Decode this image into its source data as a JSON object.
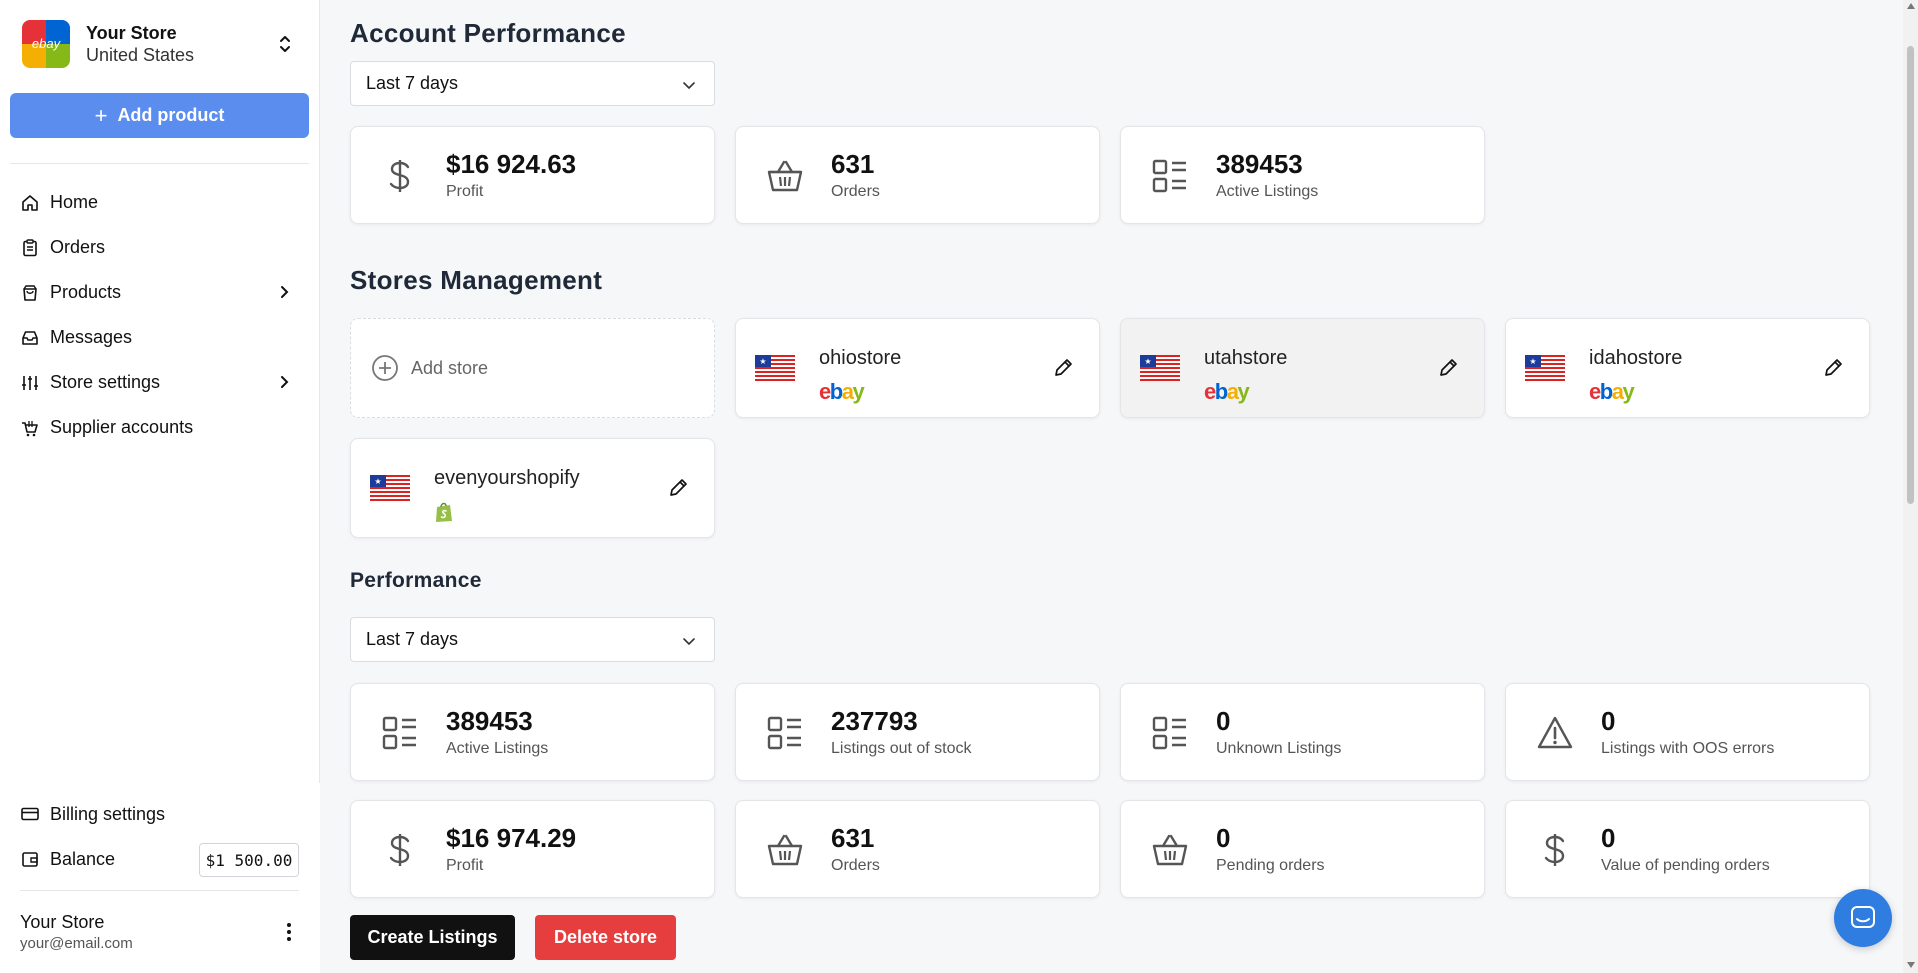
{
  "sidebar": {
    "store_name": "Your Store",
    "store_country": "United States",
    "logo_text": "ebay",
    "add_product_label": "Add product",
    "nav": [
      {
        "label": "Home",
        "icon": "home-icon"
      },
      {
        "label": "Orders",
        "icon": "clipboard-icon"
      },
      {
        "label": "Products",
        "icon": "bag-icon",
        "has_children": true
      },
      {
        "label": "Messages",
        "icon": "inbox-icon"
      },
      {
        "label": "Store settings",
        "icon": "sliders-icon",
        "has_children": true
      },
      {
        "label": "Supplier accounts",
        "icon": "cart-icon"
      }
    ],
    "billing_label": "Billing settings",
    "balance_label": "Balance",
    "balance_value": "$1 500.00",
    "user_name": "Your Store",
    "user_email": "your@email.com"
  },
  "account_performance": {
    "title": "Account Performance",
    "period": "Last 7 days",
    "cards": [
      {
        "value": "$16 924.63",
        "label": "Profit",
        "icon": "dollar-icon"
      },
      {
        "value": "631",
        "label": "Orders",
        "icon": "basket-icon"
      },
      {
        "value": "389453",
        "label": "Active Listings",
        "icon": "list-icon"
      }
    ]
  },
  "stores_management": {
    "title": "Stores Management",
    "add_store_label": "Add store",
    "stores": [
      {
        "name": "ohiostore",
        "platform": "ebay"
      },
      {
        "name": "utahstore",
        "platform": "ebay"
      },
      {
        "name": "idahostore",
        "platform": "ebay"
      },
      {
        "name": "evenyourshopify",
        "platform": "shopify"
      }
    ]
  },
  "performance": {
    "title": "Performance",
    "period": "Last 7 days",
    "cards": [
      {
        "value": "389453",
        "label": "Active Listings",
        "icon": "list-icon"
      },
      {
        "value": "237793",
        "label": "Listings out of stock",
        "icon": "list-icon"
      },
      {
        "value": "0",
        "label": "Unknown Listings",
        "icon": "list-icon"
      },
      {
        "value": "0",
        "label": "Listings with OOS errors",
        "icon": "warning-icon"
      },
      {
        "value": "$16 974.29",
        "label": "Profit",
        "icon": "dollar-icon"
      },
      {
        "value": "631",
        "label": "Orders",
        "icon": "basket-icon"
      },
      {
        "value": "0",
        "label": "Pending orders",
        "icon": "basket-icon"
      },
      {
        "value": "0",
        "label": "Value of pending orders",
        "icon": "dollar-icon"
      }
    ]
  },
  "actions": {
    "create_listings": "Create Listings",
    "delete_store": "Delete store"
  },
  "colors": {
    "primary": "#5b8def",
    "danger": "#e63e3e",
    "chat": "#2f7de1"
  }
}
